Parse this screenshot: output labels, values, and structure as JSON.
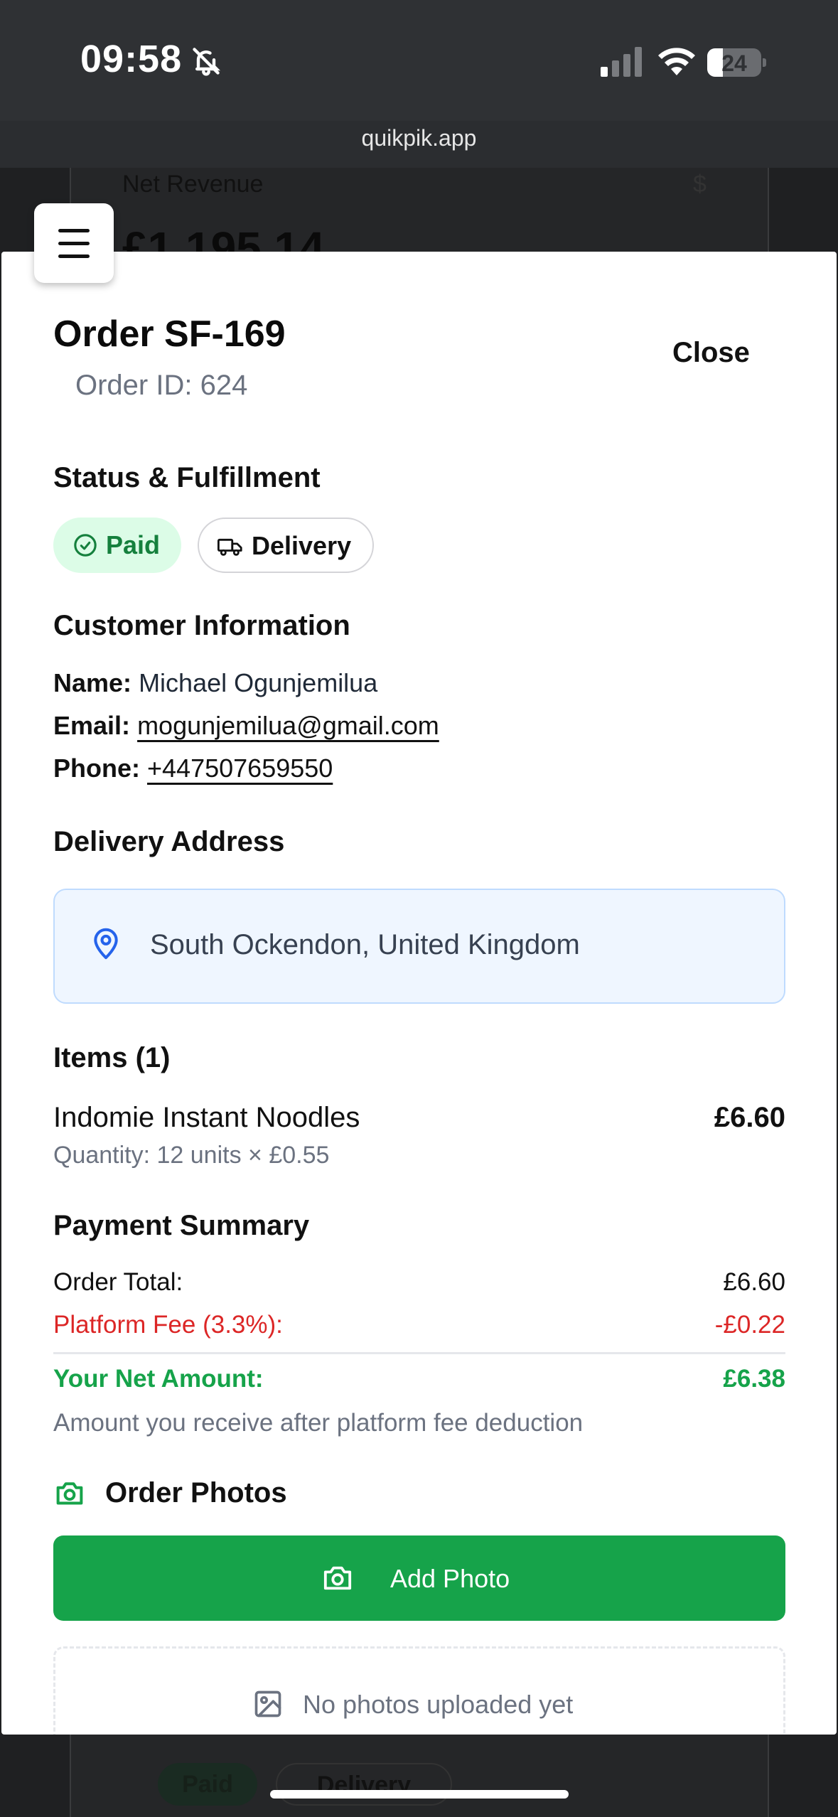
{
  "status_bar": {
    "time": "09:58",
    "battery": "24"
  },
  "browser": {
    "url": "quikpik.app"
  },
  "background": {
    "net_revenue_label": "Net Revenue",
    "currency_symbol": "$",
    "net_revenue_value": "£1,195.14",
    "paid_badge": "Paid",
    "delivery_badge": "Delivery"
  },
  "modal": {
    "title": "Order SF-169",
    "order_id": "Order ID: 624",
    "close_label": "Close",
    "status_section": {
      "heading": "Status & Fulfillment",
      "paid_badge": "Paid",
      "delivery_badge": "Delivery"
    },
    "customer": {
      "heading": "Customer Information",
      "name_label": "Name:",
      "name": "Michael Ogunjemilua",
      "email_label": "Email:",
      "email": "mogunjemilua@gmail.com",
      "phone_label": "Phone:",
      "phone": "+447507659550"
    },
    "delivery": {
      "heading": "Delivery Address",
      "address": "South Ockendon, United Kingdom"
    },
    "items": {
      "heading": "Items (1)",
      "list": [
        {
          "name": "Indomie Instant Noodles",
          "quantity": "Quantity: 12 units × £0.55",
          "price": "£6.60"
        }
      ]
    },
    "payment": {
      "heading": "Payment Summary",
      "order_total_label": "Order Total:",
      "order_total": "£6.60",
      "fee_label": "Platform Fee (3.3%):",
      "fee": "-£0.22",
      "net_label": "Your Net Amount:",
      "net": "£6.38",
      "note": "Amount you receive after platform fee deduction"
    },
    "photos": {
      "heading": "Order Photos",
      "add_button": "Add Photo",
      "empty_text": "No photos uploaded yet"
    }
  },
  "colors": {
    "accent_green": "#16a34a",
    "fee_red": "#dc2626",
    "address_bg": "#eff6ff"
  }
}
